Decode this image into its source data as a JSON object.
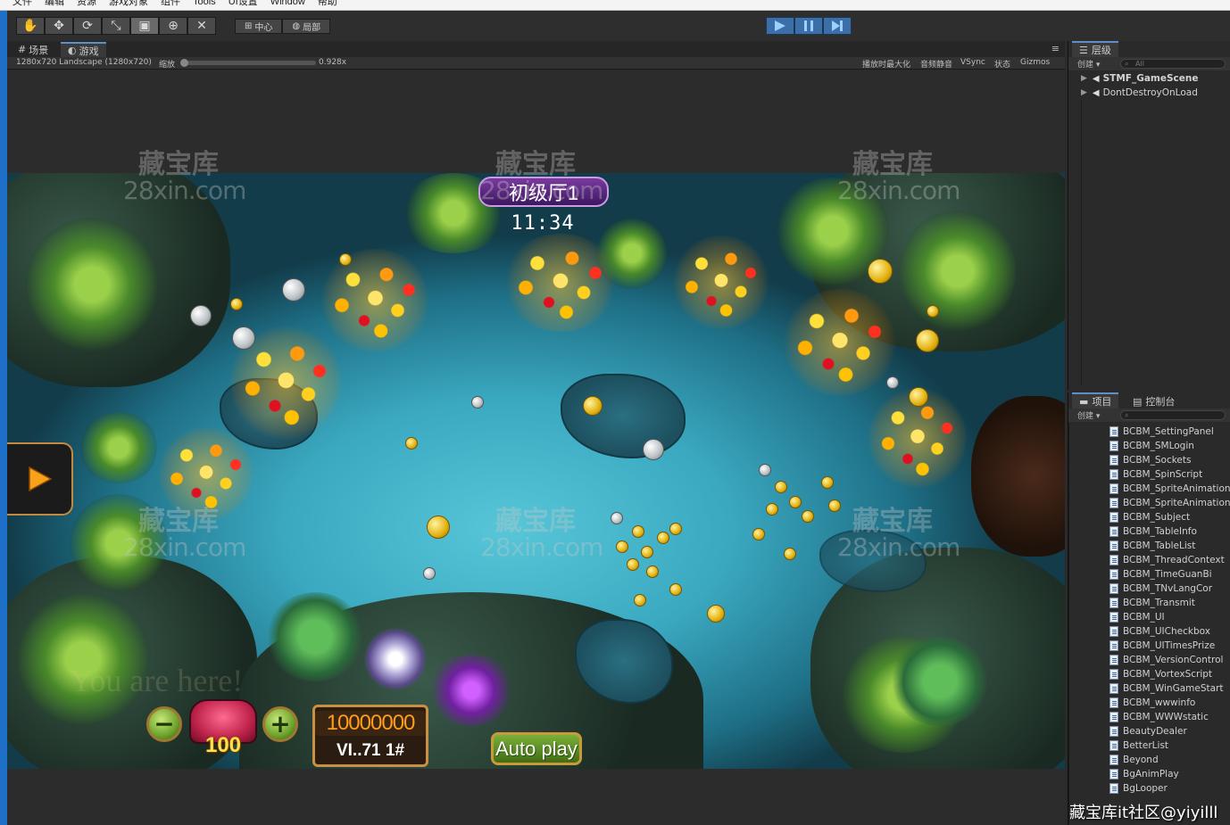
{
  "menu": [
    "文件",
    "编辑",
    "资源",
    "游戏对象",
    "组件",
    "Tools",
    "UI设置",
    "Window",
    "帮助"
  ],
  "toolbar": {
    "pivot_label": "中心",
    "space_label": "局部"
  },
  "tabs": {
    "scene": "场景",
    "game": "游戏"
  },
  "gamebar": {
    "resolution": "1280x720 Landscape (1280x720)",
    "scale_label": "缩放",
    "scale_value": "0.928x",
    "maximize": "播放时最大化",
    "mute": "音频静音",
    "vsync": "VSync",
    "stats": "状态",
    "gizmos": "Gizmos"
  },
  "game": {
    "room_title": "初级厅1",
    "timer": "11:34",
    "cannon_level": "100",
    "score": "10000000",
    "player_tag": "VI..71 1#",
    "autoplay_label": "Auto play",
    "ghost_text": "You are here!"
  },
  "hierarchy": {
    "title": "层级",
    "create": "创建",
    "search_placeholder": "All",
    "items": [
      "STMF_GameScene",
      "DontDestroyOnLoad"
    ]
  },
  "project": {
    "tab_project": "项目",
    "tab_console": "控制台",
    "create": "创建",
    "files": [
      "BCBM_SettingPanel",
      "BCBM_SMLogin",
      "BCBM_Sockets",
      "BCBM_SpinScript",
      "BCBM_SpriteAnimation",
      "BCBM_SpriteAnimation",
      "BCBM_Subject",
      "BCBM_TableInfo",
      "BCBM_TableList",
      "BCBM_ThreadContext",
      "BCBM_TimeGuanBi",
      "BCBM_TNvLangCor",
      "BCBM_Transmit",
      "BCBM_UI",
      "BCBM_UICheckbox",
      "BCBM_UITimesPrize",
      "BCBM_VersionControl",
      "BCBM_VortexScript",
      "BCBM_WinGameStart",
      "BCBM_wwwinfo",
      "BCBM_WWWstatic",
      "BeautyDealer",
      "BetterList",
      "Beyond",
      "BgAnimPlay",
      "BgLooper"
    ]
  },
  "watermark": {
    "cn": "藏宝库",
    "en": "28xin.com",
    "corner": "藏宝库it社区@yiyilll"
  },
  "colors": {
    "editor_bg": "#2b2b2b",
    "play_blue": "#3c6ea8",
    "water": "#3aa8c0",
    "title_purple": "#7a3aa0",
    "score_orange": "#ff9c1a",
    "autoplay_green": "#7ab038"
  }
}
